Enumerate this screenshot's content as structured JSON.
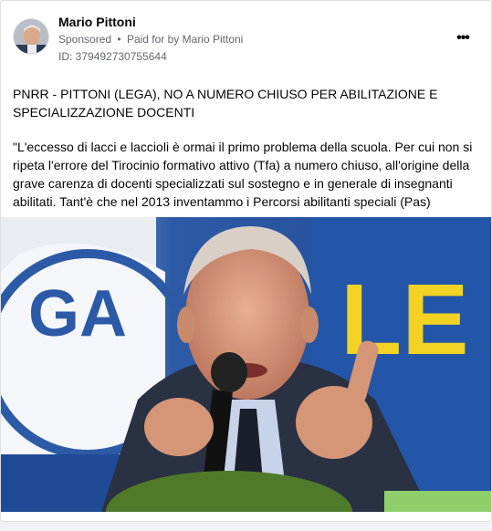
{
  "post": {
    "author": "Mario Pittoni",
    "sponsored_label": "Sponsored",
    "separator": "•",
    "paid_for_by_label": "Paid for by",
    "paid_for_by_name": "Mario Pittoni",
    "ad_id": "ID: 379492730755644",
    "more_icon": "more-horizontal-icon",
    "title": "PNRR - PITTONI (LEGA), NO A NUMERO CHIUSO PER ABILITAZIONE E SPECIALIZZAZIONE DOCENTI",
    "body": "\"L'eccesso di lacci e laccioli è ormai il primo problema della scuola. Per cui non si ripeta l'errore del Tirocinio formativo attivo (Tfa) a numero chiuso, all'origine della grave carenza di docenti specializzati sul sostegno e in generale di insegnanti abilitati. Tant'è che nel 2013 inventammo i Percorsi abilitanti speciali (Pas) senza…",
    "image_banner_left": "GA",
    "image_banner_right": "LE"
  }
}
